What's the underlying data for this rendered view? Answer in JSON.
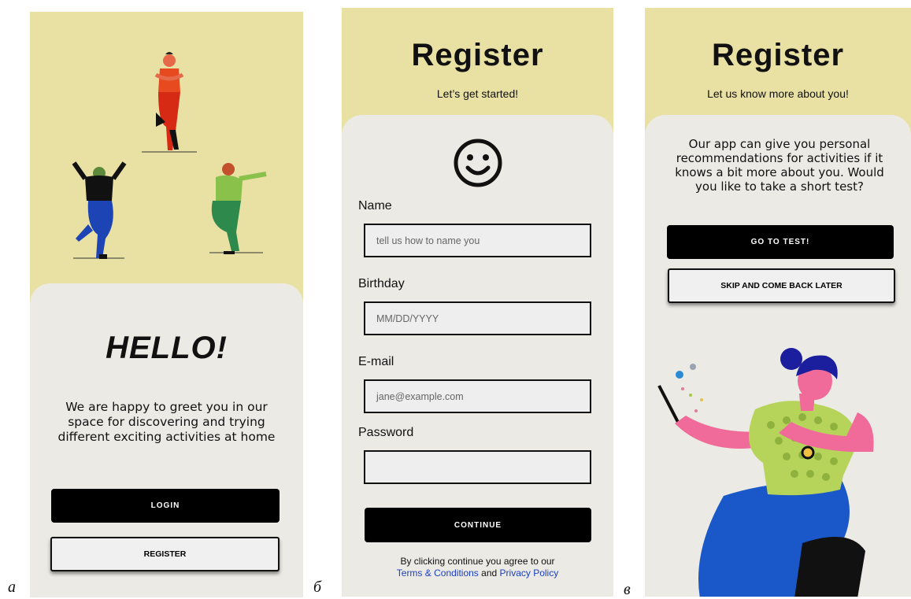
{
  "labels": {
    "a": "а",
    "b": "б",
    "c": "в"
  },
  "colors": {
    "band": "#e9e0a3",
    "card": "#eceae4",
    "primary": "#000000",
    "link": "#1a3ec5"
  },
  "screen_a": {
    "title": "HELLO!",
    "message": "We are happy to greet you in our space for discovering and trying different exciting activities at home",
    "login_label": "LOGIN",
    "register_label": "REGISTER"
  },
  "screen_b": {
    "title": "Register",
    "subtitle": "Let’s get started!",
    "avatar_icon": "smiley-face-icon",
    "fields": [
      {
        "label": "Name",
        "placeholder": "tell us how to name you"
      },
      {
        "label": "Birthday",
        "placeholder": "MM/DD/YYYY"
      },
      {
        "label": "E-mail",
        "placeholder": "jane@example.com"
      },
      {
        "label": "Password",
        "placeholder": ""
      }
    ],
    "continue_label": "CONTINUE",
    "terms_prefix": "By clicking continue you agree to our",
    "terms_link": "Terms & Conditions",
    "terms_and": "and",
    "privacy_link": "Privacy Policy"
  },
  "screen_c": {
    "title": "Register",
    "subtitle": "Let us know more about you!",
    "message": "Our app can give you personal recommendations for activities if it knows a bit more about you. Would you like to take a short test?",
    "test_label": "GO TO TEST!",
    "skip_label": "SKIP AND COME BACK LATER"
  }
}
